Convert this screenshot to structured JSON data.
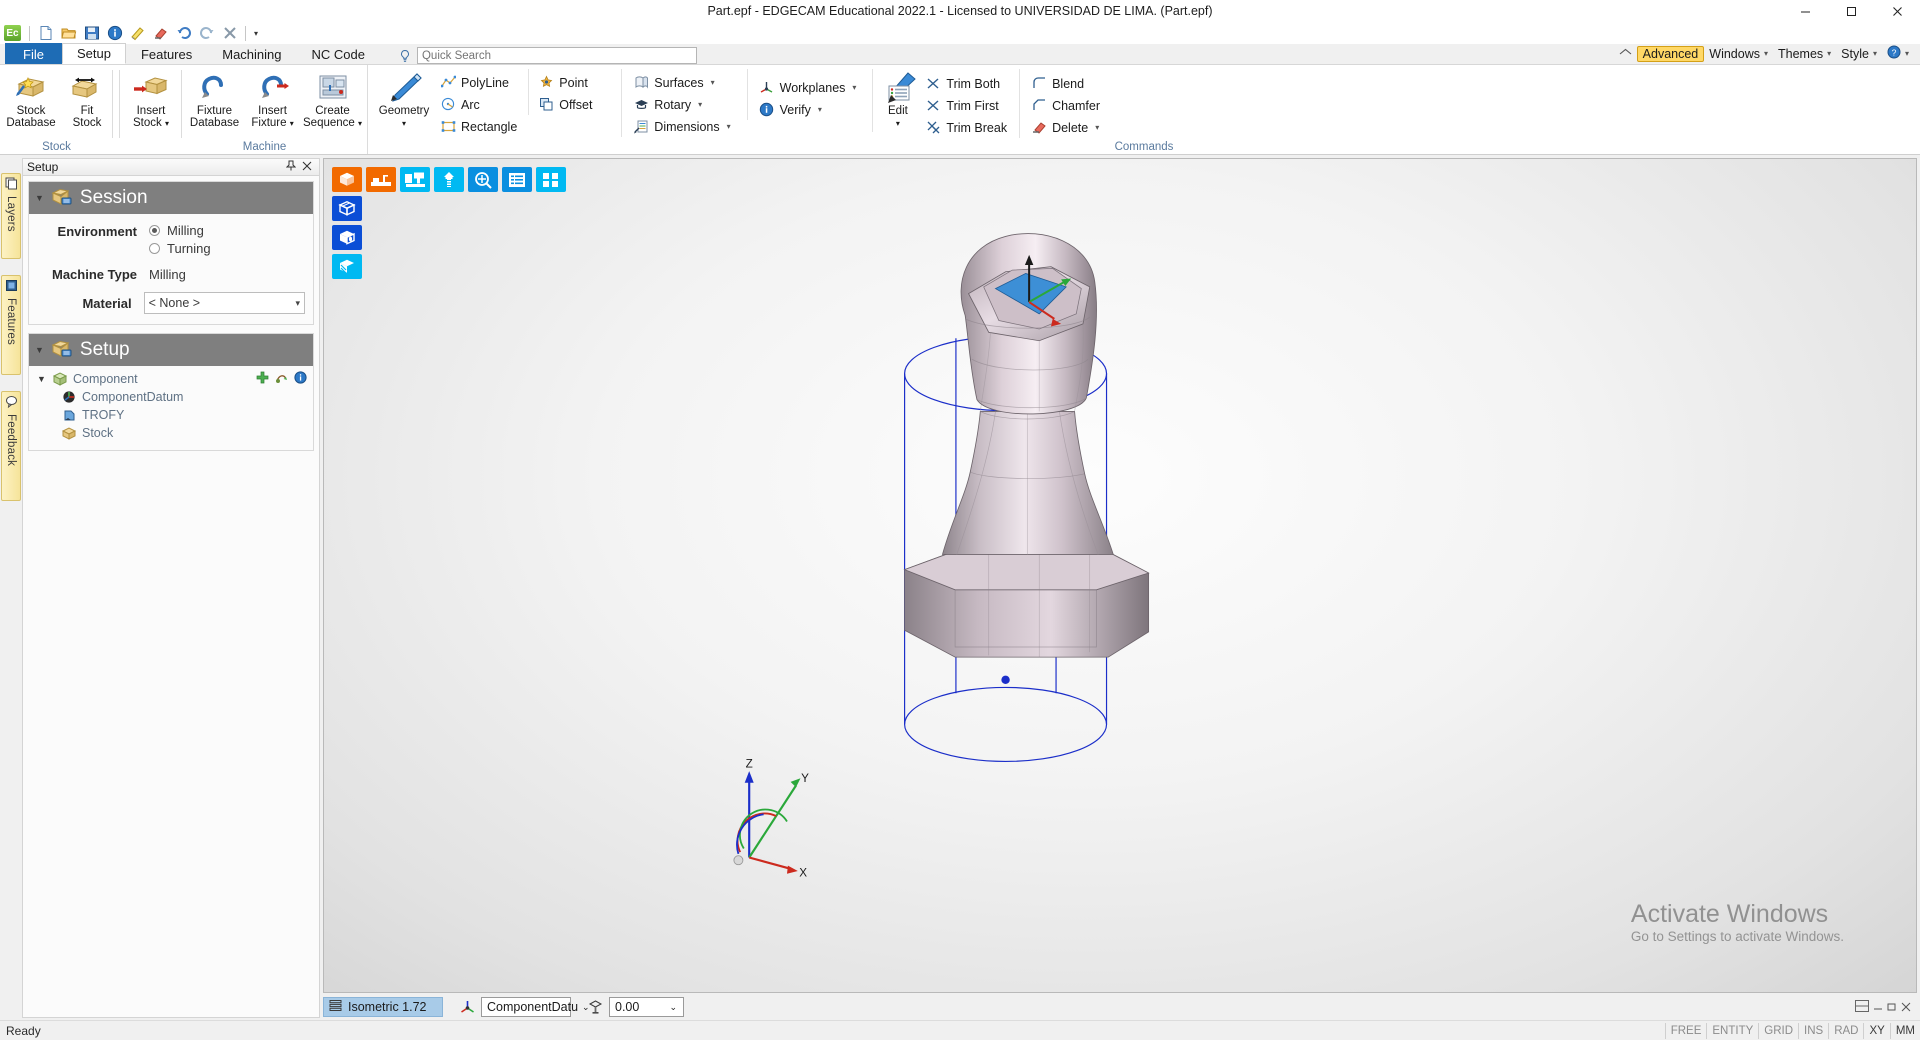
{
  "window": {
    "title": "Part.epf - EDGECAM Educational 2022.1  - Licensed to UNIVERSIDAD DE LIMA. (Part.epf)",
    "minimize": "–",
    "maximize": "□",
    "close": "✕"
  },
  "quick_access": {
    "logo_text": "Ec",
    "icons": [
      "new-document-icon",
      "open-folder-icon",
      "save-icon",
      "info-icon",
      "measure-icon",
      "eraser-icon",
      "undo-icon",
      "redo-icon",
      "delete-icon"
    ],
    "overflow_caret": "▾"
  },
  "ribbon": {
    "tabs": [
      {
        "label": "File",
        "type": "file"
      },
      {
        "label": "Setup",
        "type": "active"
      },
      {
        "label": "Features",
        "type": "normal"
      },
      {
        "label": "Machining",
        "type": "normal"
      },
      {
        "label": "NC Code",
        "type": "normal"
      }
    ],
    "search": {
      "placeholder": "Quick Search",
      "value": ""
    },
    "right": {
      "home_icon": "home-icon",
      "advanced": "Advanced",
      "windows": "Windows",
      "themes": "Themes",
      "style": "Style",
      "help_icon": "help-icon",
      "caret": "▾"
    },
    "groups": [
      {
        "name": "Stock",
        "label": "Stock",
        "big_buttons": [
          {
            "label": "Stock\nDatabase",
            "icon": "stock-database-icon",
            "dropdown": false
          },
          {
            "label": "Fit\nStock",
            "icon": "fit-stock-icon",
            "dropdown": false
          },
          {
            "label": "Insert\nStock",
            "icon": "insert-stock-icon",
            "dropdown": true
          }
        ]
      },
      {
        "name": "Machine",
        "label": "Machine",
        "big_buttons": [
          {
            "label": "Fixture\nDatabase",
            "icon": "fixture-database-icon",
            "dropdown": false
          },
          {
            "label": "Insert\nFixture",
            "icon": "insert-fixture-icon",
            "dropdown": true
          },
          {
            "label": "Create\nSequence",
            "icon": "create-sequence-icon",
            "dropdown": true
          }
        ]
      },
      {
        "name": "Commands",
        "label": "Commands",
        "big_buttons": [
          {
            "label": "Geometry",
            "icon": "geometry-pencil-icon",
            "dropdown": true
          },
          {
            "label": "Edit",
            "icon": "edit-icon",
            "dropdown": true
          }
        ],
        "small_columns": [
          [
            {
              "label": "PolyLine",
              "icon": "polyline-icon",
              "dropdown": false
            },
            {
              "label": "Arc",
              "icon": "arc-icon",
              "dropdown": false
            },
            {
              "label": "Rectangle",
              "icon": "rectangle-icon",
              "dropdown": false
            }
          ],
          [
            {
              "label": "Point",
              "icon": "point-icon",
              "dropdown": false
            },
            {
              "label": "Offset",
              "icon": "offset-icon",
              "dropdown": false
            }
          ],
          [
            {
              "label": "Surfaces",
              "icon": "surfaces-icon",
              "dropdown": true
            },
            {
              "label": "Rotary",
              "icon": "rotary-icon",
              "dropdown": true
            },
            {
              "label": "Dimensions",
              "icon": "dimensions-icon",
              "dropdown": true
            }
          ],
          [
            {
              "label": "Workplanes",
              "icon": "workplanes-icon",
              "dropdown": true
            },
            {
              "label": "Verify",
              "icon": "verify-icon",
              "dropdown": true
            }
          ],
          [
            {
              "label": "Trim Both",
              "icon": "trim-both-icon",
              "dropdown": false
            },
            {
              "label": "Trim First",
              "icon": "trim-first-icon",
              "dropdown": false
            },
            {
              "label": "Trim Break",
              "icon": "trim-break-icon",
              "dropdown": false
            }
          ],
          [
            {
              "label": "Blend",
              "icon": "blend-icon",
              "dropdown": false
            },
            {
              "label": "Chamfer",
              "icon": "chamfer-icon",
              "dropdown": false
            },
            {
              "label": "Delete",
              "icon": "delete-red-icon",
              "dropdown": true
            }
          ]
        ]
      }
    ]
  },
  "vdock": {
    "tabs": [
      {
        "label": "Layers",
        "icon": "layers-icon"
      },
      {
        "label": "Features",
        "icon": "features-cube-icon"
      },
      {
        "label": "Feedback",
        "icon": "feedback-bubble-icon"
      }
    ]
  },
  "left_panel": {
    "header": {
      "title": "Setup",
      "pin_icon": "pin-icon",
      "close_icon": "close-icon"
    },
    "session_card": {
      "title": "Session",
      "collapse_icon": "triangle-down-icon",
      "icon": "session-box-icon",
      "environment_label": "Environment",
      "environment_options": [
        {
          "label": "Milling",
          "selected": true
        },
        {
          "label": "Turning",
          "selected": false
        }
      ],
      "machine_type_label": "Machine Type",
      "machine_type_value": "Milling",
      "material_label": "Material",
      "material_value": "< None >"
    },
    "setup_card": {
      "title": "Setup",
      "collapse_icon": "triangle-down-icon",
      "icon": "setup-box-icon",
      "tree": [
        {
          "label": "Component",
          "icon": "component-cube-icon",
          "level": 0,
          "expanded": true,
          "actions": [
            "add-green-plus-icon",
            "transform-icon",
            "info-blue-icon"
          ]
        },
        {
          "label": "ComponentDatum",
          "icon": "datum-icon",
          "level": 1
        },
        {
          "label": "TROFY",
          "icon": "solid-icon",
          "level": 1
        },
        {
          "label": "Stock",
          "icon": "stock-box-icon",
          "level": 1
        }
      ]
    }
  },
  "viewport": {
    "toolbar_rows": [
      [
        {
          "icon": "shaded-cube-icon",
          "color": "#f26a00"
        },
        {
          "icon": "machine-bed-icon",
          "color": "#f26a00"
        },
        {
          "icon": "machine-sim-icon",
          "color": "#00b9f2"
        },
        {
          "icon": "tool-icon",
          "color": "#00b9f2"
        },
        {
          "icon": "zoom-icon",
          "color": "#0a8fe0"
        },
        {
          "icon": "list-view-icon",
          "color": "#0a8fe0"
        },
        {
          "icon": "grid-view-icon",
          "color": "#00b9f2"
        }
      ],
      [
        {
          "icon": "wireframe-cube-icon",
          "color": "#0b4ed6"
        }
      ],
      [
        {
          "icon": "shaded-solid-cube-icon",
          "color": "#0b4ed6"
        }
      ],
      [
        {
          "icon": "section-cube-icon",
          "color": "#00b9f2"
        }
      ]
    ],
    "axis_triad": {
      "x_label": "X",
      "y_label": "Y",
      "z_label": "Z"
    },
    "watermark": {
      "line1": "Activate Windows",
      "line2": "Go to Settings to activate Windows."
    }
  },
  "status_row": {
    "view_icon": "view-list-icon",
    "view_label": "Isometric 1.72",
    "workplane_icon": "workplane-triad-icon",
    "workplane_value": "ComponentDatu",
    "level_icon": "level-icon",
    "level_value": "0.00",
    "caret": "⌄"
  },
  "bottom_bar": {
    "status_text": "Ready",
    "cells": [
      "FREE",
      "ENTITY",
      "GRID",
      "INS",
      "RAD",
      "XY",
      "MM"
    ],
    "dark_cells": [
      "XY",
      "MM"
    ]
  }
}
